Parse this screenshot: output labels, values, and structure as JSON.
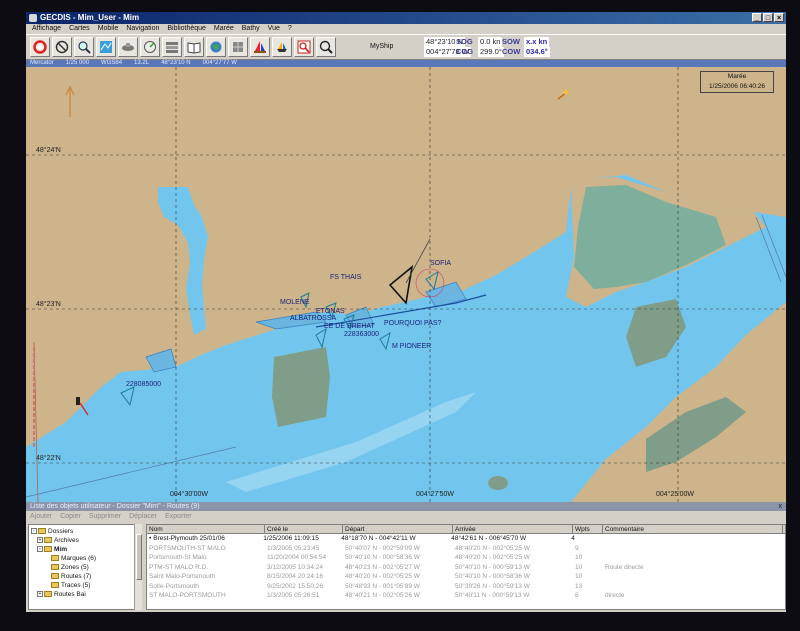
{
  "window": {
    "title": "GECDIS - Mim_User - Mim"
  },
  "menu": [
    "Affichage",
    "Cartes",
    "Mobile",
    "Navigation",
    "Bibliothèque",
    "Marée",
    "Bathy",
    "Vue",
    "?"
  ],
  "toolbar": {
    "icons": [
      "lifebuoy-icon",
      "no-entry-icon",
      "zoom-icon",
      "chart-layers-icon",
      "ship-icon",
      "radar-icon",
      "stack-icon",
      "book-icon",
      "globe-icon",
      "grid-icon",
      "sail-icon",
      "boat-icon",
      "zoom-area-icon",
      "magnifier-icon"
    ],
    "ship_label": "MyShip",
    "lat": "48°23'10 N",
    "lon": "004°27'78 W",
    "sog_label": "SOG",
    "sog_value": "0.0 kn",
    "cog_label": "COG",
    "cog_value": "299.0°",
    "sow_label": "SOW",
    "sow_value": "x.x kn",
    "cow_label": "COW",
    "cow_value": "034.6°"
  },
  "infobar": [
    "Mercator",
    "1/25 000",
    "WGS84",
    "13.2L",
    "48°23'10 N",
    "004°27'77 W"
  ],
  "chart": {
    "scale_box": {
      "line1": "Marée",
      "line2": "1/25/2006 06:40:26"
    },
    "lat_labels": [
      "48°24'N",
      "48°23'N",
      "48°22'N"
    ],
    "lon_labels": [
      "004°30'00W",
      "004°27'50W",
      "004°25'00W"
    ],
    "vessels": [
      "FS THAIS",
      "MOLENE",
      "ETONAS",
      "ALBATROSSA",
      "EE DE BREHAT",
      "SOFIA",
      "POURQUOI PAS?",
      "M PIONEER",
      "228085000",
      "228363000"
    ]
  },
  "panel": {
    "title": "Liste des objets utilisateur - Dossier \"Mim\" - Routes (9)",
    "close": "x",
    "toolbar": [
      "Ajouter",
      "Copier",
      "Supprimer",
      "Déplacer",
      "Exporter"
    ],
    "tree": [
      {
        "label": "Dossiers",
        "level": 0,
        "pm": "-"
      },
      {
        "label": "Archives",
        "level": 1,
        "pm": "+"
      },
      {
        "label": "Mim",
        "level": 1,
        "pm": "-"
      },
      {
        "label": "Marques (6)",
        "level": 2,
        "pm": ""
      },
      {
        "label": "Zones (5)",
        "level": 2,
        "pm": ""
      },
      {
        "label": "Routes (7)",
        "level": 2,
        "pm": ""
      },
      {
        "label": "Traces (5)",
        "level": 2,
        "pm": ""
      },
      {
        "label": "Routes Bai",
        "level": 1,
        "pm": "+"
      }
    ],
    "columns": [
      "Nom",
      "Créé le",
      "Départ",
      "Arrivée",
      "Wpts",
      "Commentaire"
    ],
    "rows": [
      [
        "Brest-Plymouth 25/01/06",
        "1/25/2006 11:09:15",
        "48°18'70 N - 004°42'11 W",
        "48°42'61 N - 006°45'70 W",
        "4",
        ""
      ],
      [
        "PORTSMOUTH-ST MALO",
        "1/3/2005 05:23:45",
        "50°40'07 N - 002°59'09 W",
        "48°40'20 N - 002°05'25 W",
        "9",
        ""
      ],
      [
        "Portsmouth-St Malo",
        "11/20/2004 00:54:54",
        "50°40'10 N - 000°58'36 W",
        "48°40'20 N - 002°05'25 W",
        "10",
        ""
      ],
      [
        "PTM-ST MALO R.D.",
        "3/12/2005 10:34:24",
        "48°40'23 N - 002°05'27 W",
        "50°40'10 N - 000°59'13 W",
        "10",
        "Route  directe"
      ],
      [
        "Saint Malo-Portsmouth",
        "8/15/2004 20:24:16",
        "48°40'20 N - 002°05'25 W",
        "50°40'10 N - 000°58'36 W",
        "10",
        ""
      ],
      [
        "Solle-Portsmouth",
        "9/25/2002 15:50:26",
        "50°48'93 N - 001°05'89 W",
        "50°39'26 N - 000°59'13 W",
        "13",
        ""
      ],
      [
        "ST MALO-PORTSMOUTH",
        "1/3/2005 05:26:51",
        "48°40'21 N - 002°05'26 W",
        "50°40'11 N - 000°59'13 W",
        "8",
        "directe"
      ]
    ]
  }
}
